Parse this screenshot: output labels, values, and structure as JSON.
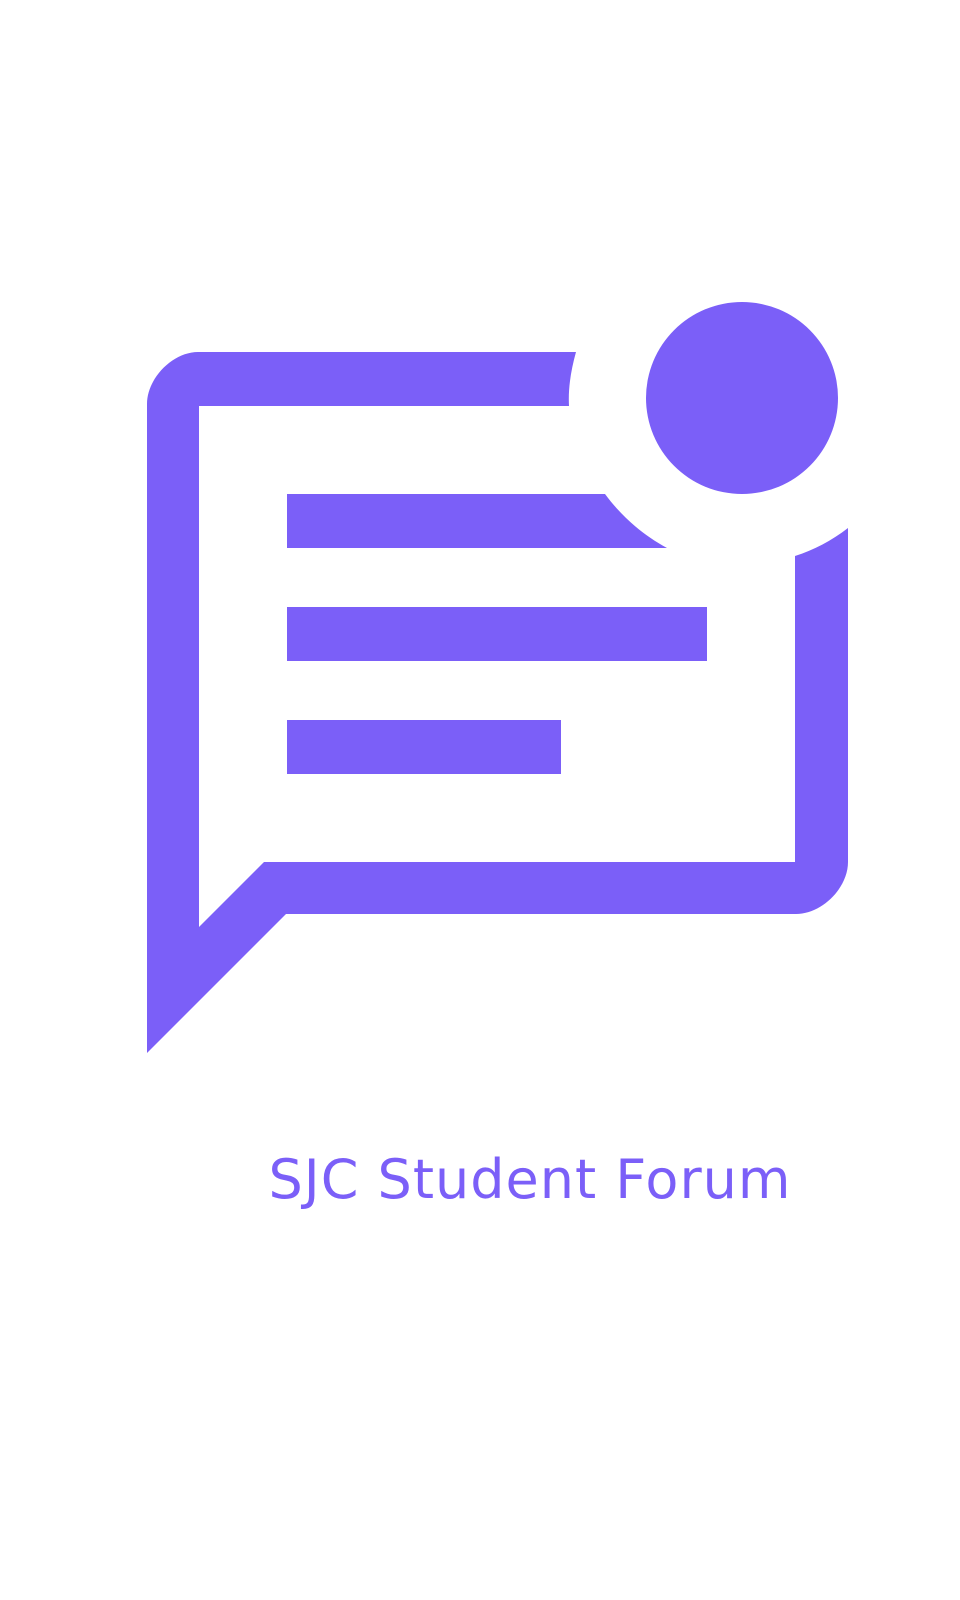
{
  "app": {
    "title": "SJC Student Forum"
  },
  "logo": {
    "icon": "forum-notification-icon"
  },
  "colors": {
    "brand": "#7B5FF8",
    "background": "#FFFFFF"
  }
}
